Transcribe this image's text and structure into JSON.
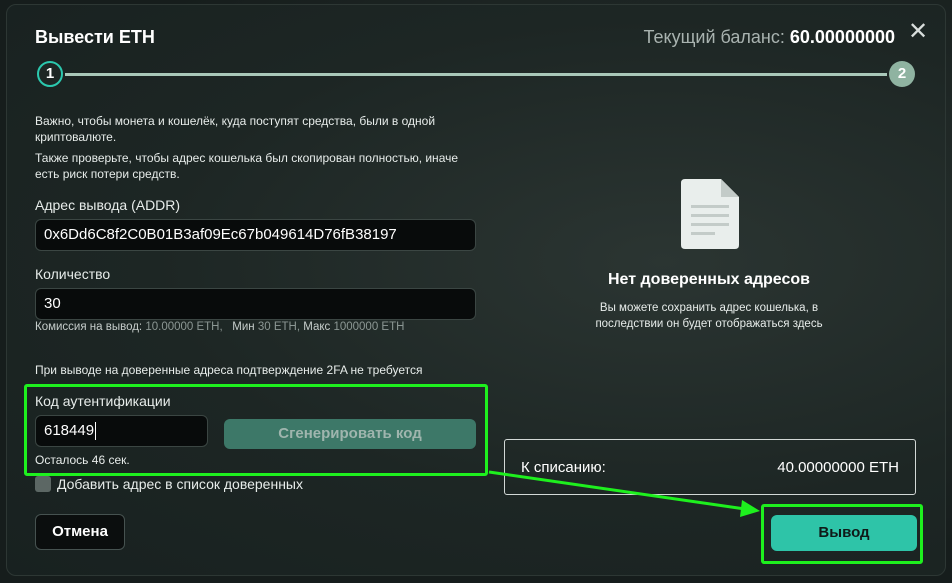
{
  "modal": {
    "title": "Вывести ETH",
    "balance_label": "Текущий баланс",
    "balance_value": "60.00000000",
    "close_glyph": "✕",
    "steps": [
      "1",
      "2"
    ],
    "current_step": 1
  },
  "notes": {
    "line1": "Важно, чтобы монета и кошелёк, куда поступят средства, были в одной криптовалюте.",
    "line2": "Также проверьте, чтобы адрес кошелька был скопирован полностью, иначе есть риск потери средств."
  },
  "address": {
    "label": "Адрес вывода (ADDR)",
    "value": "0x6Dd6C8f2C0B01B3af09Ec67b049614D76fB38197"
  },
  "amount": {
    "label": "Количество",
    "value": "30",
    "fee_label": "Комиссия на вывод:",
    "fee_value": "10.00000 ETH,",
    "min_label": "Мин",
    "min_value": "30 ETH,",
    "max_label": "Макс",
    "max_value": "1000000 ETH"
  },
  "twofa": {
    "note": "При выводе на доверенные адреса подтверждение 2FA не требуется",
    "label": "Код аутентификации",
    "value": "618449",
    "generate_label": "Сгенерировать код",
    "remaining": "Осталось 46 сек."
  },
  "trusted": {
    "checkbox_label": "Добавить адрес в список доверенных",
    "checked": false,
    "empty_icon": "document-icon",
    "empty_title": "Нет доверенных адресов",
    "empty_desc": "Вы можете сохранить адрес кошелька, в последствии он будет отображаться здесь"
  },
  "summary": {
    "charge_label": "К списанию:",
    "charge_value": "40.00000000 ETH"
  },
  "actions": {
    "cancel_label": "Отмена",
    "submit_label": "Вывод"
  },
  "colors": {
    "accent": "#2ec4a8",
    "highlight": "#1ef01e",
    "step_line": "#a9c8b9"
  }
}
